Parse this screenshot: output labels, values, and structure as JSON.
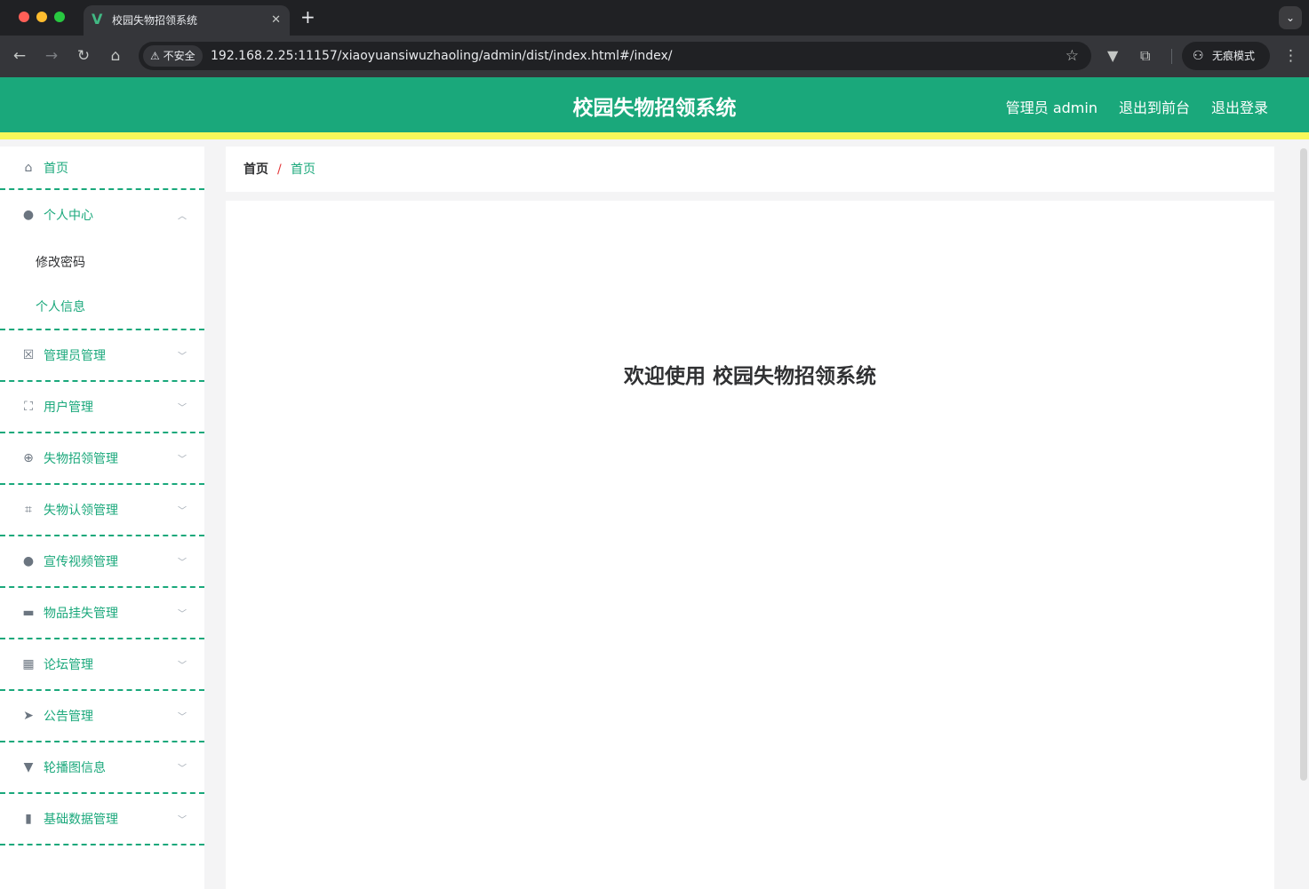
{
  "browser": {
    "tab_title": "校园失物招领系统",
    "tab_favicon": "V",
    "security_label": "不安全",
    "url": "192.168.2.25:11157/xiaoyuansiwuzhaoling/admin/dist/index.html#/index/",
    "incognito_label": "无痕模式",
    "icons": {
      "back": "back-arrow-icon",
      "forward": "forward-arrow-icon",
      "reload": "reload-icon",
      "home": "home-icon",
      "warning": "warning-icon",
      "bookmark": "star-icon",
      "extension": "puzzle-icon",
      "vue_devtools": "vue-icon",
      "incognito": "incognito-icon",
      "menu": "kebab-menu-icon"
    }
  },
  "header": {
    "title": "校园失物招领系统",
    "user_label": "管理员 admin",
    "frontend_link": "退出到前台",
    "logout_link": "退出登录"
  },
  "sidebar": {
    "home": {
      "label": "首页",
      "icon": "home-icon"
    },
    "personal": {
      "label": "个人中心",
      "icon": "user-icon",
      "expanded": true,
      "children": [
        {
          "label": "修改密码",
          "color": "#303133"
        },
        {
          "label": "个人信息",
          "color": "#1aa87b"
        }
      ]
    },
    "items": [
      {
        "label": "管理员管理",
        "icon": "clipboard-x-icon"
      },
      {
        "label": "用户管理",
        "icon": "fullscreen-icon"
      },
      {
        "label": "失物招领管理",
        "icon": "crosshair-icon"
      },
      {
        "label": "失物认领管理",
        "icon": "crop-icon"
      },
      {
        "label": "宣传视频管理",
        "icon": "user-icon"
      },
      {
        "label": "物品挂失管理",
        "icon": "briefcase-icon"
      },
      {
        "label": "论坛管理",
        "icon": "grid-icon"
      },
      {
        "label": "公告管理",
        "icon": "send-icon"
      },
      {
        "label": "轮播图信息",
        "icon": "brush-icon"
      },
      {
        "label": "基础数据管理",
        "icon": "ticket-icon"
      }
    ]
  },
  "breadcrumb": {
    "home": "首页",
    "separator": "/",
    "current": "首页"
  },
  "main": {
    "welcome": "欢迎使用 校园失物招领系统"
  },
  "colors": {
    "brand": "#1aa87b",
    "header_accent": "#f8f85a",
    "separator_red": "#e4393c"
  }
}
